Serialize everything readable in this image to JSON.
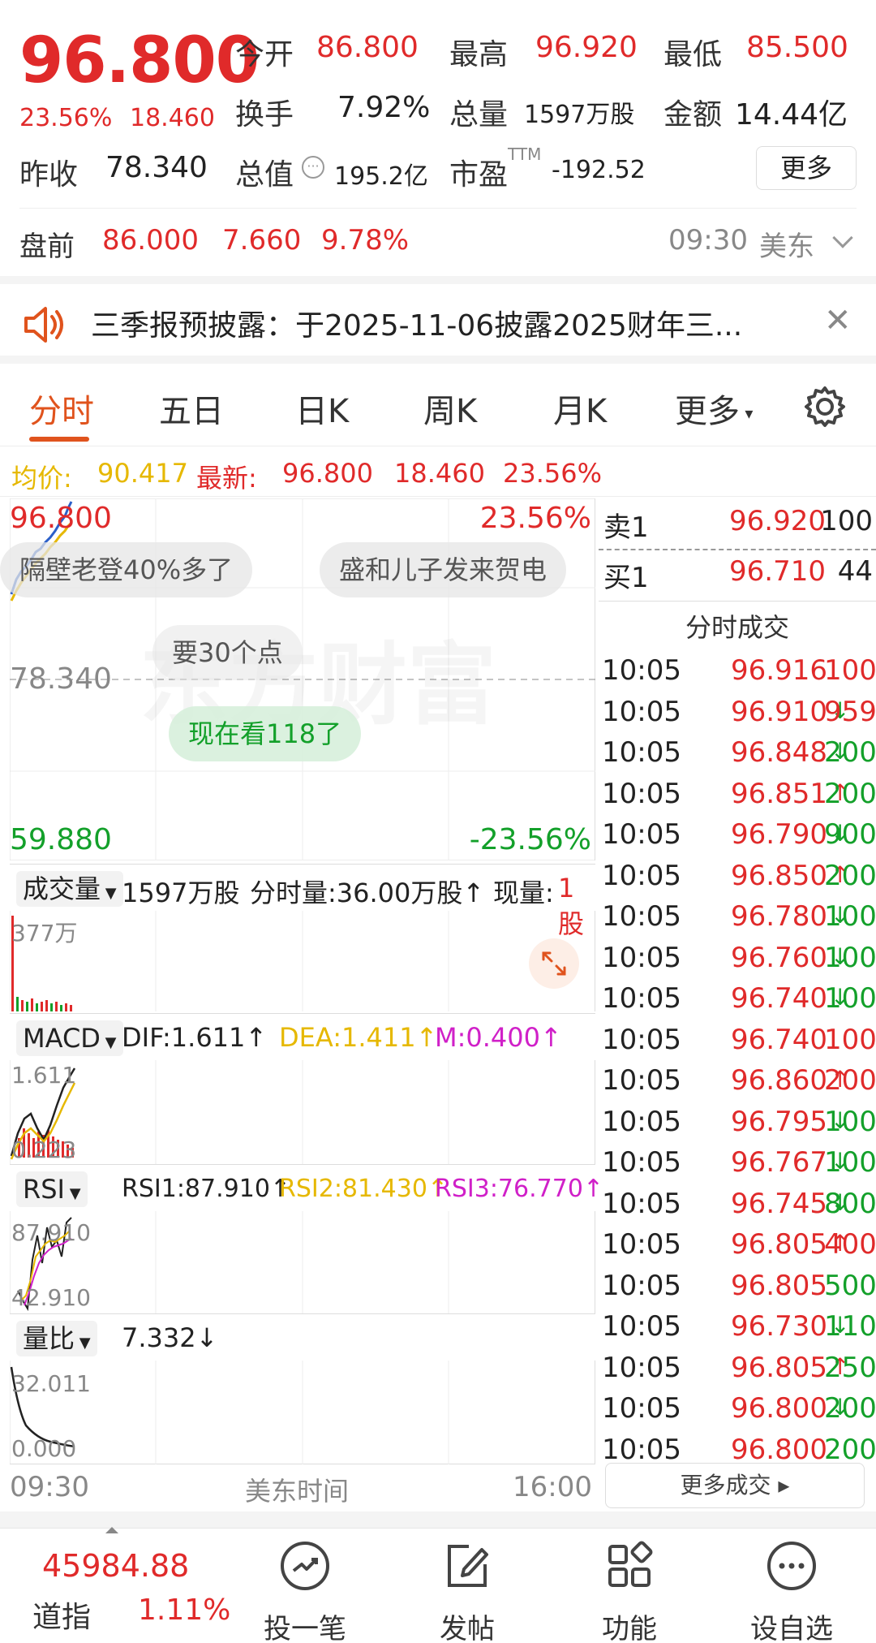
{
  "quote": {
    "price": "96.800",
    "change_pct": "23.56%",
    "change": "18.460",
    "open_label": "今开",
    "open": "86.800",
    "high_label": "最高",
    "high": "96.920",
    "low_label": "最低",
    "low": "85.500",
    "turnover_label": "换手",
    "turnover": "7.92%",
    "volume_label": "总量",
    "volume": "1597万股",
    "amount_label": "金额",
    "amount": "14.44亿",
    "prev_close_label": "昨收",
    "prev_close": "78.340",
    "mktcap_label": "总值",
    "mktcap": "195.2亿",
    "pe_label": "市盈",
    "pe_sup": "TTM",
    "pe": "-192.52",
    "more_label": "更多"
  },
  "premarket": {
    "label": "盘前",
    "price": "86.000",
    "change": "7.660",
    "change_pct": "9.78%",
    "time": "09:30",
    "market": "美东"
  },
  "notice": {
    "text": "三季报预披露：于2025-11-06披露2025财年三..."
  },
  "tabs": [
    {
      "label": "分时"
    },
    {
      "label": "五日"
    },
    {
      "label": "日K"
    },
    {
      "label": "周K"
    },
    {
      "label": "月K"
    },
    {
      "label": "更多"
    }
  ],
  "avg_row": {
    "avg_label": "均价:",
    "avg": "90.417",
    "latest_label": "最新:",
    "latest": "96.800",
    "change": "18.460",
    "change_pct": "23.56%"
  },
  "chart": {
    "top_price": "96.800",
    "top_pct": "23.56%",
    "mid_price": "78.340",
    "bottom_price": "59.880",
    "bottom_pct": "-23.56%",
    "watermark": "东方财富",
    "bubbles": [
      "隔壁老登40%多了",
      "盛和儿子发来贺电",
      "要30个点",
      "现在看118了"
    ]
  },
  "volume_panel": {
    "selector": "成交量",
    "total": "1597万股",
    "minute_vol": "分时量:36.00万股↑",
    "now_label": "现量:",
    "now": "1股",
    "max": "377万"
  },
  "macd_panel": {
    "selector": "MACD",
    "dif": "DIF:1.611↑",
    "dea": "DEA:1.411↑",
    "m": "M:0.400↑",
    "hi": "1.611",
    "lo": "0.223"
  },
  "rsi_panel": {
    "selector": "RSI",
    "rsi1": "RSI1:87.910↑",
    "rsi2": "RSI2:81.430↑",
    "rsi3": "RSI3:76.770↑",
    "hi": "87.910",
    "lo": "42.910"
  },
  "ratio_panel": {
    "selector": "量比",
    "value": "7.332↓",
    "hi": "32.011",
    "lo": "0.000"
  },
  "time_axis": {
    "start": "09:30",
    "middle": "美东时间",
    "end": "16:00"
  },
  "book": {
    "ask_label": "卖1",
    "ask_price": "96.920",
    "ask_size": "100",
    "bid_label": "买1",
    "bid_price": "96.710",
    "bid_size": "44",
    "ticks_title": "分时成交",
    "more_label": "更多成交"
  },
  "ticks": [
    {
      "t": "10:05",
      "p": "96.916",
      "d": "",
      "a": "100",
      "c": "red"
    },
    {
      "t": "10:05",
      "p": "96.910",
      "d": "↓",
      "a": "959",
      "c": "red"
    },
    {
      "t": "10:05",
      "p": "96.848",
      "d": "↓",
      "a": "200",
      "c": "green"
    },
    {
      "t": "10:05",
      "p": "96.851",
      "d": "↑",
      "a": "200",
      "c": "green"
    },
    {
      "t": "10:05",
      "p": "96.790",
      "d": "↓",
      "a": "900",
      "c": "green"
    },
    {
      "t": "10:05",
      "p": "96.850",
      "d": "↑",
      "a": "200",
      "c": "green"
    },
    {
      "t": "10:05",
      "p": "96.780",
      "d": "↓",
      "a": "100",
      "c": "green"
    },
    {
      "t": "10:05",
      "p": "96.760",
      "d": "↓",
      "a": "100",
      "c": "green"
    },
    {
      "t": "10:05",
      "p": "96.740",
      "d": "↓",
      "a": "100",
      "c": "green"
    },
    {
      "t": "10:05",
      "p": "96.740",
      "d": "",
      "a": "100",
      "c": "red"
    },
    {
      "t": "10:05",
      "p": "96.860",
      "d": "↑",
      "a": "2000",
      "c": "red"
    },
    {
      "t": "10:05",
      "p": "96.795",
      "d": "↓",
      "a": "100",
      "c": "green"
    },
    {
      "t": "10:05",
      "p": "96.767",
      "d": "↓",
      "a": "100",
      "c": "green"
    },
    {
      "t": "10:05",
      "p": "96.745",
      "d": "↓",
      "a": "800",
      "c": "green"
    },
    {
      "t": "10:05",
      "p": "96.805",
      "d": "↑",
      "a": "400",
      "c": "red"
    },
    {
      "t": "10:05",
      "p": "96.805",
      "d": "",
      "a": "500",
      "c": "green"
    },
    {
      "t": "10:05",
      "p": "96.730",
      "d": "↓",
      "a": "110",
      "c": "green"
    },
    {
      "t": "10:05",
      "p": "96.805",
      "d": "↑",
      "a": "250",
      "c": "green"
    },
    {
      "t": "10:05",
      "p": "96.800",
      "d": "↓",
      "a": "200",
      "c": "green"
    },
    {
      "t": "10:05",
      "p": "96.800",
      "d": "",
      "a": "200",
      "c": "green"
    }
  ],
  "bottom_bar": {
    "index_value": "45984.88",
    "index_name": "道指",
    "index_pct": "1.11%",
    "items": [
      {
        "label": "投一笔",
        "icon": "trend-icon"
      },
      {
        "label": "发帖",
        "icon": "edit-icon"
      },
      {
        "label": "功能",
        "icon": "grid-icon"
      },
      {
        "label": "设自选",
        "icon": "more-icon"
      }
    ]
  },
  "colors": {
    "up": "#e02a2a",
    "down": "#13a02a",
    "accent": "#e0531d",
    "avg": "#e6b800"
  }
}
